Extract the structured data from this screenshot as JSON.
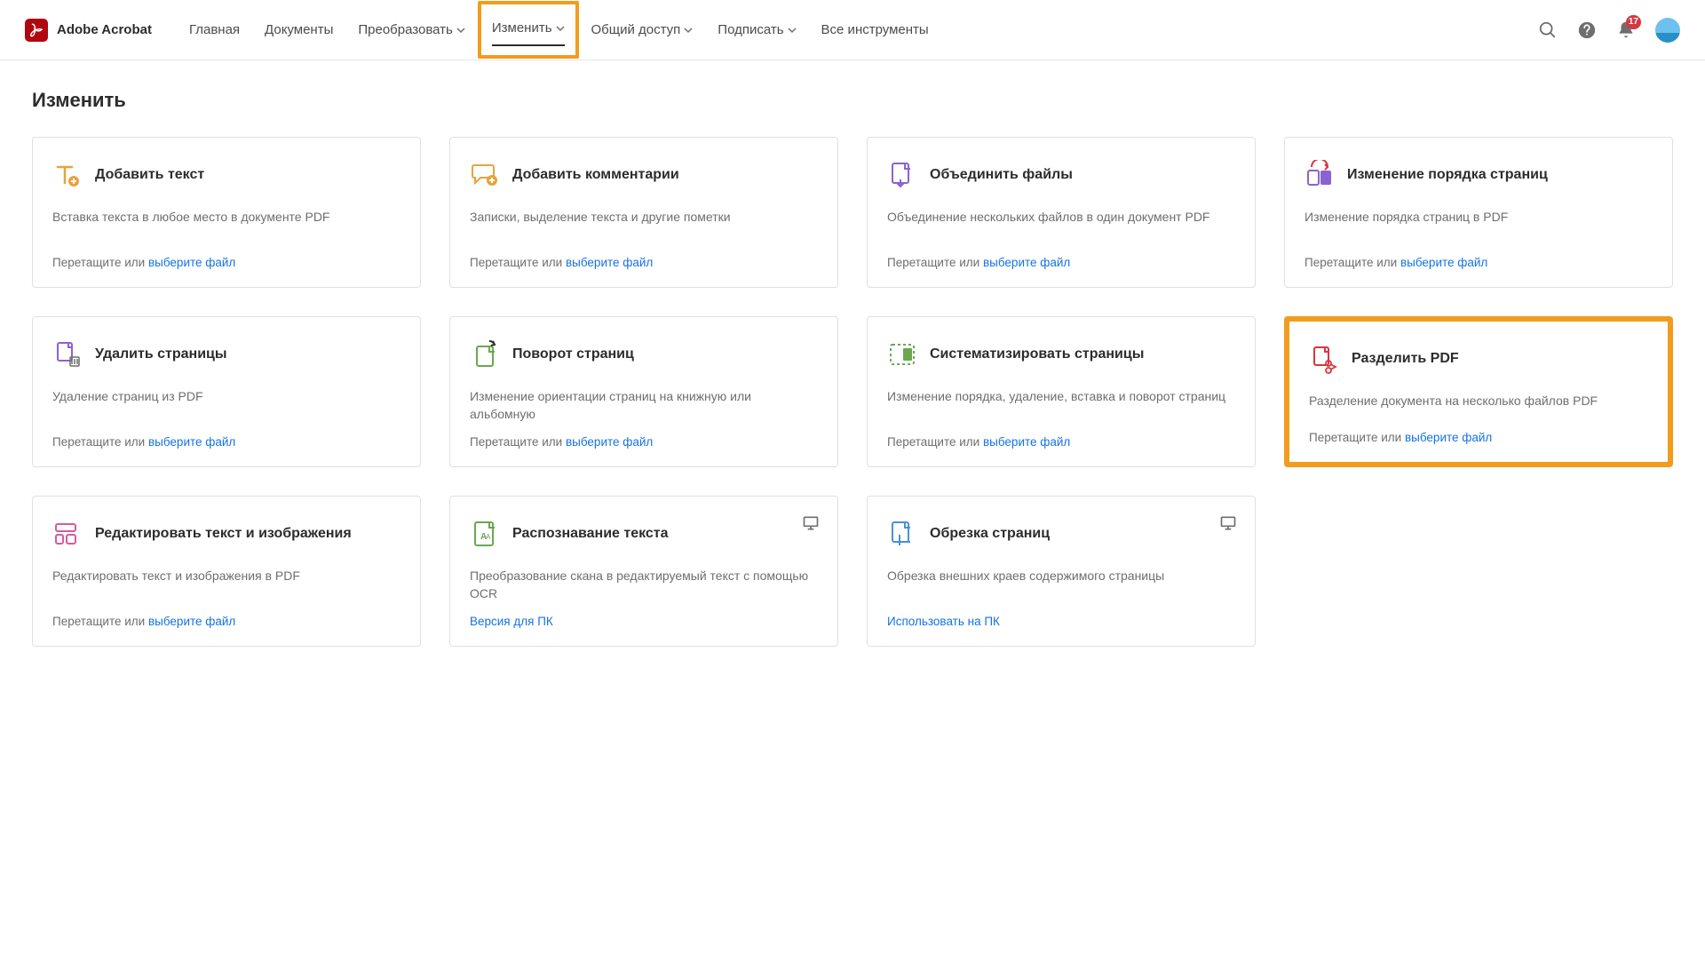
{
  "brand": {
    "name": "Adobe Acrobat"
  },
  "nav": {
    "home": "Главная",
    "documents": "Документы",
    "convert": "Преобразовать",
    "edit": "Изменить",
    "share": "Общий доступ",
    "sign": "Подписать",
    "all_tools": "Все инструменты"
  },
  "notifications": {
    "count": "17"
  },
  "page": {
    "title": "Изменить",
    "drag_prefix": "Перетащите или ",
    "select_file": "выберите файл"
  },
  "cards": {
    "add_text": {
      "title": "Добавить текст",
      "desc": "Вставка текста в любое место в документе PDF"
    },
    "add_comments": {
      "title": "Добавить комментарии",
      "desc": "Записки, выделение текста и другие пометки"
    },
    "combine": {
      "title": "Объединить файлы",
      "desc": "Объединение нескольких файлов в один документ PDF"
    },
    "reorder": {
      "title": "Изменение порядка страниц",
      "desc": "Изменение порядка страниц в PDF"
    },
    "delete": {
      "title": "Удалить страницы",
      "desc": "Удаление страниц из PDF"
    },
    "rotate": {
      "title": "Поворот страниц",
      "desc": "Изменение ориентации страниц на книжную или альбомную"
    },
    "organize": {
      "title": "Систематизировать страницы",
      "desc": "Изменение порядка, удаление, вставка и поворот страниц"
    },
    "split": {
      "title": "Разделить PDF",
      "desc": "Разделение документа на несколько файлов PDF"
    },
    "edit_ti": {
      "title": "Редактировать текст и изображения",
      "desc": "Редактировать текст и изображения в PDF"
    },
    "ocr": {
      "title": "Распознавание текста",
      "desc": "Преобразование скана в редактируемый текст с помощью OCR",
      "link": "Версия для ПК"
    },
    "crop": {
      "title": "Обрезка страниц",
      "desc": "Обрезка внешних краев содержимого страницы",
      "link": "Использовать на ПК"
    }
  }
}
